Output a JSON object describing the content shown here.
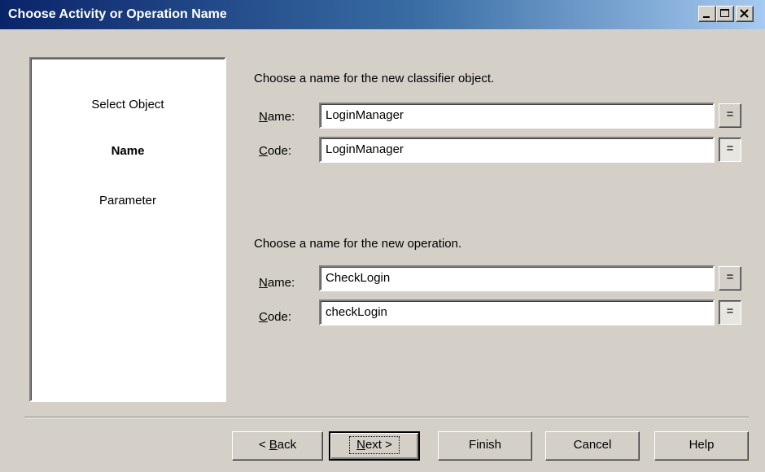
{
  "window": {
    "title": "Choose Activity or Operation Name",
    "controls": [
      "minimize-icon",
      "maximize-icon",
      "close-icon"
    ]
  },
  "steps": {
    "items": [
      {
        "label": "Select Object",
        "active": false
      },
      {
        "label": "Name",
        "active": true
      },
      {
        "label": "Parameter",
        "active": false
      }
    ]
  },
  "classifier": {
    "prompt": "Choose a name for the new classifier object.",
    "name_label_u": "N",
    "name_label_rest": "ame:",
    "name_value": "LoginManager",
    "code_label_u": "C",
    "code_label_rest": "ode:",
    "code_value": "LoginManager",
    "eq_label": "="
  },
  "operation": {
    "prompt": "Choose a name for the new operation.",
    "name_label_u": "N",
    "name_label_rest": "ame:",
    "name_value": "CheckLogin",
    "code_label_u": "C",
    "code_label_rest": "ode:",
    "code_value": "checkLogin",
    "eq_label": "="
  },
  "buttons": {
    "back_prefix": "< ",
    "back_u": "B",
    "back_rest": "ack",
    "next_u": "N",
    "next_rest": "ext >",
    "finish": "Finish",
    "cancel": "Cancel",
    "help": "Help"
  }
}
